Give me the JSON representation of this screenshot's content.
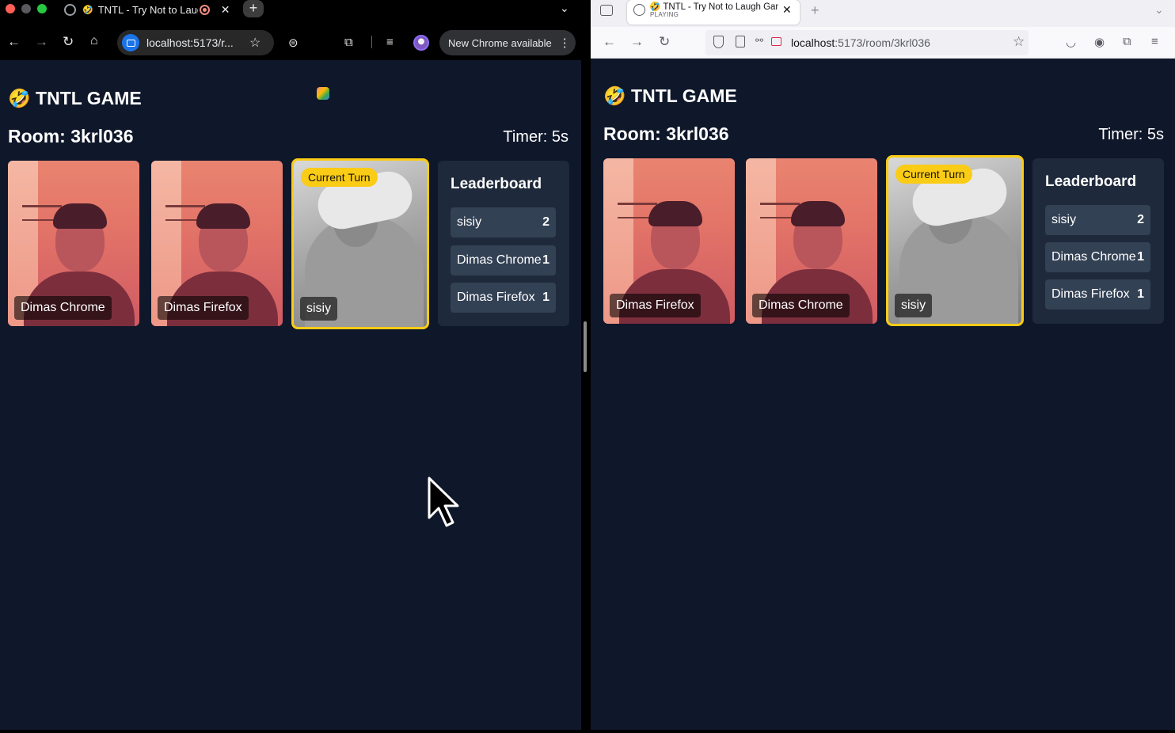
{
  "chrome": {
    "tab_title": "TNTL - Try Not to Laugh Game",
    "tab_emoji": "🤣",
    "url_display": "localhost:5173/r...",
    "update_button": "New Chrome available",
    "game": {
      "title": "TNTL GAME",
      "title_emoji": "🤣",
      "room": "Room: 3krl036",
      "timer": "Timer: 5s",
      "players": [
        {
          "name": "Dimas Chrome",
          "camera": "pink"
        },
        {
          "name": "Dimas Firefox",
          "camera": "pink"
        },
        {
          "name": "sisiy",
          "camera": "gray",
          "current_turn": true
        }
      ],
      "current_turn_label": "Current Turn",
      "leaderboard_title": "Leaderboard",
      "leaderboard": [
        {
          "name": "sisiy",
          "score": "2"
        },
        {
          "name": "Dimas Chrome",
          "score": "1"
        },
        {
          "name": "Dimas Firefox",
          "score": "1"
        }
      ]
    }
  },
  "firefox": {
    "tab_title": "TNTL - Try Not to Laugh Game",
    "tab_emoji": "🤣",
    "tab_status": "PLAYING",
    "url_host": "localhost",
    "url_path": ":5173/room/3krl036",
    "game": {
      "title": "TNTL GAME",
      "title_emoji": "🤣",
      "room": "Room: 3krl036",
      "timer": "Timer: 5s",
      "players": [
        {
          "name": "Dimas Firefox",
          "camera": "pink"
        },
        {
          "name": "Dimas Chrome",
          "camera": "pink"
        },
        {
          "name": "sisiy",
          "camera": "gray",
          "current_turn": true
        }
      ],
      "current_turn_label": "Current Turn",
      "leaderboard_title": "Leaderboard",
      "leaderboard": [
        {
          "name": "sisiy",
          "score": "2"
        },
        {
          "name": "Dimas Chrome",
          "score": "1"
        },
        {
          "name": "Dimas Firefox",
          "score": "1"
        }
      ]
    }
  },
  "colors": {
    "page_bg": "#0f172a",
    "panel_bg": "#1e293b",
    "row_bg": "#334155",
    "current_turn_accent": "#facc15"
  }
}
